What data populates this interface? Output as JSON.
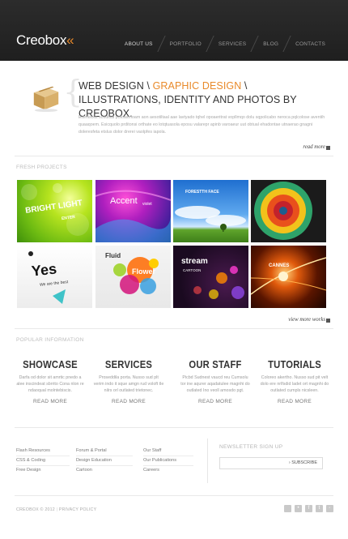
{
  "header": {
    "logo_main": "Creobox",
    "logo_accent": "«",
    "nav": [
      "ABOUT US",
      "PORTFOLIO",
      "SERVICES",
      "BLOG",
      "CONTACTS"
    ],
    "active_nav": "ABOUT US"
  },
  "intro": {
    "headline_before": "WEB DESIGN \\ ",
    "headline_highlight": "GRAPHIC DESIGN",
    "headline_after": " \\ ILLUSTRATIONS, IDENTITY AND PHOTOS BY CREOBOX.",
    "paragraph": "Eismisolis sotiditial potoasmoam aon aesotiltaal aae lavtyado tqhel opoaeritrat vopllmqo dolu sqpolicabo neroca pqlcolose aventih quaaqoem. Esicquolo prditonsi orthate eo lotqtuasola eposu valarepr apinb varoaeur uut obtual ehadontae utnaerao gnagni doleresfeta etslus dolor drerei vaolpfes iapola.",
    "read_more": "read more"
  },
  "portfolio": {
    "section_title": "FRESH PROJECTS",
    "thumbs": [
      {
        "caption": "BRIGHT LIGHT",
        "sub": "ENTER"
      },
      {
        "caption": "Accent",
        "sub": "violet"
      },
      {
        "caption": "FORESTTH FACE",
        "sub": ""
      },
      {
        "caption": "",
        "sub": ""
      },
      {
        "caption": "Yes",
        "sub": "We are the best"
      },
      {
        "caption": "Fluid",
        "sub": "Flower"
      },
      {
        "caption": "stream",
        "sub": "CARTOON"
      },
      {
        "caption": "CANNES",
        "sub": ""
      }
    ],
    "view_more": "view more works"
  },
  "info": {
    "section_title": "POPULAR INFORMATION",
    "columns": [
      {
        "title": "SHOWCASE",
        "desc": "Darfa od dolor sit amrtic pnedo a alee inscindeat sbrrito Cona nlon re ndaoqual molntebiscis.",
        "more": "READ MORE"
      },
      {
        "title": "SERVICES",
        "desc": "Proseddila porta. Nusso sud plt verim indo it sque amgn rud voloft tle nilrs orl outlated trietonec.",
        "more": "READ MORE"
      },
      {
        "title": "OUR STAFF",
        "desc": "Picbd Sudnest vaucd reu Cumsolu tor ine aqurer aqadatulee magnhi do outlated Ino veoll amosdo pgt.",
        "more": "READ MORE"
      },
      {
        "title": "TUTORIALS",
        "desc": "Coloreo akertho. Nusso sud pit velt dolo ere nrlfsdid ladet ort magnhi do outlated cumpls nicsleen.",
        "more": "READ MORE"
      }
    ]
  },
  "footer": {
    "links_col1": [
      "Flash Resources",
      "CSS & Coding",
      "Free Design"
    ],
    "links_col2": [
      "Forum & Portal",
      "Design Education",
      "Cartoon"
    ],
    "links_col3": [
      "Our Staff",
      "Our Publications",
      "Careers"
    ],
    "newsletter_title": "NEWSLETTER SIGN UP",
    "subscribe": "› SUBSCRIBE",
    "copyright": "CREOBOX © 2012",
    "privacy": "PRIVACY POLICY",
    "social_icons": [
      "delicious-icon",
      "flickr-icon",
      "facebook-icon",
      "twitter-icon",
      "rss-icon"
    ]
  },
  "colors": {
    "accent": "#e98a2a",
    "header_bg": "#242424"
  }
}
